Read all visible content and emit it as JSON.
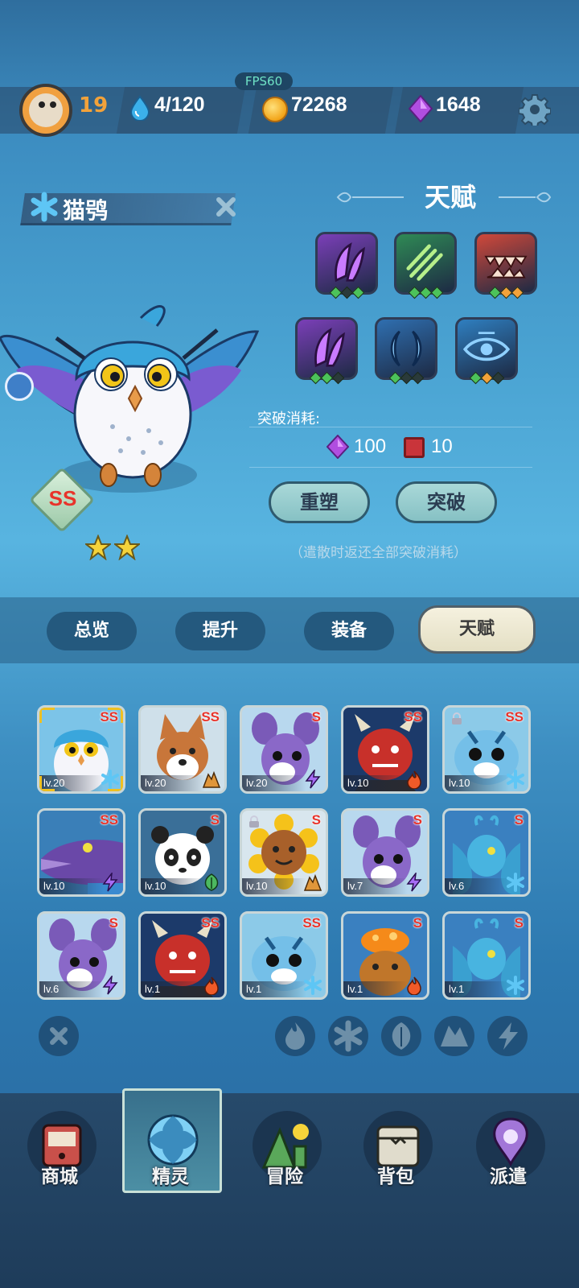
{
  "hud": {
    "fps": "FPS60",
    "level": "19",
    "stamina": "4/120",
    "coins": "72268",
    "gems": "1648"
  },
  "pet": {
    "name": "猫鸮",
    "rank": "SS",
    "stars": 2
  },
  "talent": {
    "title": "天赋",
    "skills": [
      {
        "icon": "purple-wing-icon",
        "bg": "#7b3fb8",
        "pips": [
          "green",
          "dark",
          "green"
        ]
      },
      {
        "icon": "green-claw-icon",
        "bg": "#2f8a55",
        "pips": [
          "green",
          "green",
          "green"
        ]
      },
      {
        "icon": "red-fang-icon",
        "bg": "#d0483a",
        "pips": [
          "green",
          "orange",
          "orange"
        ]
      },
      {
        "icon": "purple-wing-icon",
        "bg": "#7b3fb8",
        "pips": [
          "green",
          "green",
          "dark"
        ]
      },
      {
        "icon": "blue-moon-icon",
        "bg": "#2f6fb0",
        "pips": [
          "green",
          "dark",
          "dark"
        ]
      },
      {
        "icon": "blue-eye-icon",
        "bg": "#2f7fc0",
        "pips": [
          "green",
          "orange",
          "dark"
        ]
      }
    ],
    "cost_label": "突破消耗:",
    "cost_gems": "100",
    "cost_books": "10",
    "reset_button": "重塑",
    "breakthrough_button": "突破",
    "note": "（遣散时返还全部突破消耗）"
  },
  "tabs": [
    "总览",
    "提升",
    "装备",
    "天赋"
  ],
  "active_tab": "天赋",
  "pets": [
    {
      "name": "owl",
      "rank": "SS",
      "level": "lv.20",
      "element": "ice",
      "bg": "#7cc4e8",
      "selected": true
    },
    {
      "name": "shiba",
      "rank": "SS",
      "level": "lv.20",
      "element": "earth",
      "bg": "#cfe0ea"
    },
    {
      "name": "purple-rat",
      "rank": "S",
      "level": "lv.20",
      "element": "thunder",
      "bg": "#b8d8ee"
    },
    {
      "name": "red-demon",
      "rank": "SS",
      "level": "lv.10",
      "element": "fire",
      "bg": "#1c3a6a"
    },
    {
      "name": "blue-tiger",
      "rank": "SS",
      "level": "lv.10",
      "element": "ice",
      "bg": "#8ccae8",
      "locked": true
    },
    {
      "name": "crocodile",
      "rank": "SS",
      "level": "lv.10",
      "element": "thunder",
      "bg": "#3a7fb8"
    },
    {
      "name": "panda",
      "rank": "S",
      "level": "lv.10",
      "element": "grass",
      "bg": "#3a6f98"
    },
    {
      "name": "sunflower",
      "rank": "S",
      "level": "lv.10",
      "element": "earth",
      "bg": "#d8e6ee",
      "locked": true
    },
    {
      "name": "purple-rat",
      "rank": "S",
      "level": "lv.7",
      "element": "thunder",
      "bg": "#b8d8ee"
    },
    {
      "name": "blue-fairy",
      "rank": "S",
      "level": "lv.6",
      "element": "ice",
      "bg": "#3a80c0"
    },
    {
      "name": "purple-rat",
      "rank": "S",
      "level": "lv.6",
      "element": "thunder",
      "bg": "#b8d8ee"
    },
    {
      "name": "red-demon",
      "rank": "SS",
      "level": "lv.1",
      "element": "fire",
      "bg": "#1c3a6a"
    },
    {
      "name": "blue-tiger",
      "rank": "SS",
      "level": "lv.1",
      "element": "ice",
      "bg": "#8ccae8"
    },
    {
      "name": "mushroom-toad",
      "rank": "S",
      "level": "lv.1",
      "element": "fire",
      "bg": "#3a80c0"
    },
    {
      "name": "blue-fairy",
      "rank": "S",
      "level": "lv.1",
      "element": "ice",
      "bg": "#3a80c0"
    }
  ],
  "filters": [
    "clear-filter-icon",
    "fire-icon",
    "ice-icon",
    "grass-icon",
    "earth-icon",
    "thunder-icon"
  ],
  "nav": [
    {
      "label": "商城",
      "icon": "shop-icon"
    },
    {
      "label": "精灵",
      "icon": "spirit-icon"
    },
    {
      "label": "冒险",
      "icon": "adventure-icon"
    },
    {
      "label": "背包",
      "icon": "bag-icon"
    },
    {
      "label": "派遣",
      "icon": "dispatch-icon"
    }
  ],
  "active_nav": "精灵",
  "colors": {
    "rank_red": "#e8332a",
    "level_orange": "#f2a23a",
    "fps_green": "#6fe3c6"
  }
}
